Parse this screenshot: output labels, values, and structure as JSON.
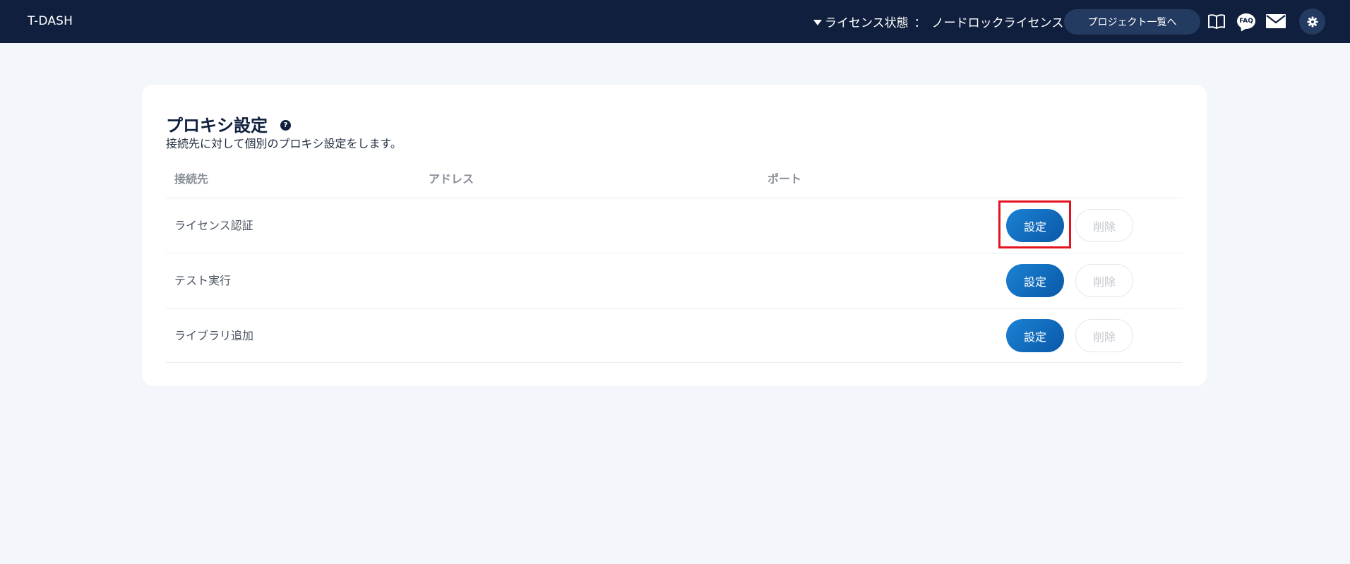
{
  "header": {
    "brand": "T-DASH",
    "license_label": "ライセンス状態",
    "license_sep": "：",
    "license_value": "ノードロックライセンス",
    "project_button": "プロジェクト一覧へ",
    "faq_label": "FAQ",
    "icons": [
      "book-icon",
      "faq-icon",
      "mail-icon",
      "gear-icon"
    ],
    "bg_color": "#0f1f3d"
  },
  "card": {
    "title": "プロキシ設定",
    "help_glyph": "?",
    "subtitle": "接続先に対して個別のプロキシ設定をします。",
    "columns": {
      "destination": "接続先",
      "address": "アドレス",
      "port": "ポート"
    },
    "rows": [
      {
        "label": "ライセンス認証",
        "set_label": "設定",
        "delete_label": "削除"
      },
      {
        "label": "テスト実行",
        "set_label": "設定",
        "delete_label": "削除"
      },
      {
        "label": "ライブラリ追加",
        "set_label": "設定",
        "delete_label": "削除"
      }
    ]
  },
  "colors": {
    "primary_button": "#1b82d4",
    "highlight": "#e3141f",
    "page_bg": "#f3f6fa"
  }
}
